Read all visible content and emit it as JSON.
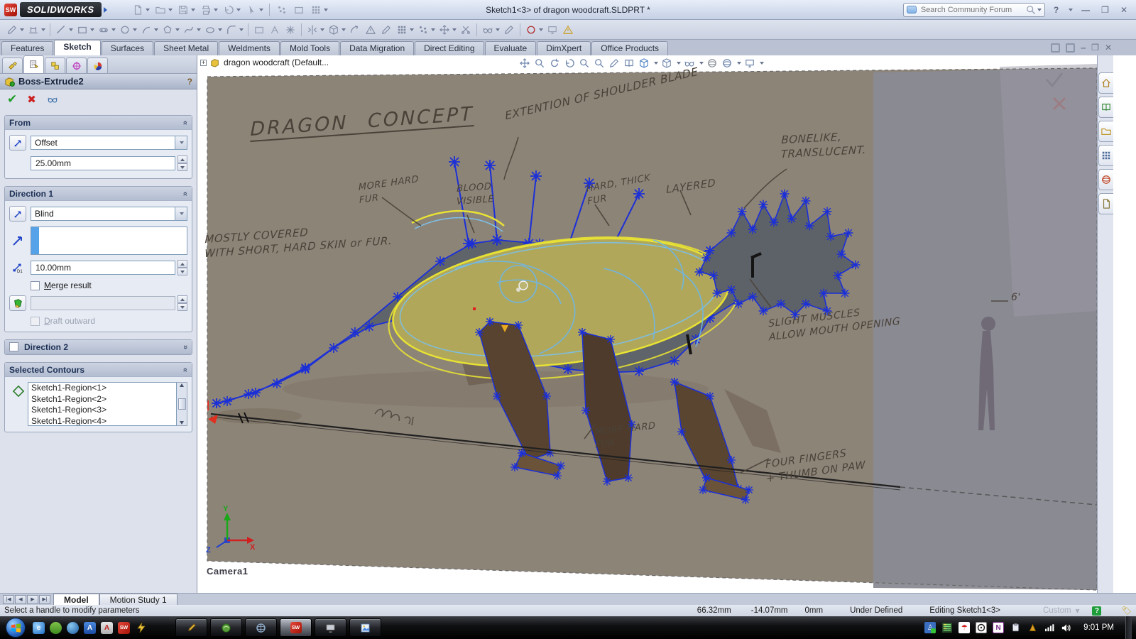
{
  "titlebar": {
    "brand": "SOLIDWORKS",
    "title": "Sketch1<3> of dragon woodcraft.SLDPRT *",
    "search_placeholder": "Search Community Forum"
  },
  "command_tabs": {
    "items": [
      "Features",
      "Sketch",
      "Surfaces",
      "Sheet Metal",
      "Weldments",
      "Mold Tools",
      "Data Migration",
      "Direct Editing",
      "Evaluate",
      "DimXpert",
      "Office Products"
    ],
    "active": "Sketch"
  },
  "feature_tree": {
    "document": "dragon woodcraft  (Default..."
  },
  "property_manager": {
    "title": "Boss-Extrude2",
    "help": "?",
    "from_group": {
      "label": "From",
      "start_condition": "Offset",
      "offset_value": "25.00mm"
    },
    "direction1_group": {
      "label": "Direction 1",
      "end_condition": "Blind",
      "depth_value": "10.00mm",
      "merge_checkbox": "Merge result",
      "draft_value": "",
      "draft_checkbox": "Draft outward",
      "depth_icon": "D1"
    },
    "direction2_group": {
      "label": "Direction 2"
    },
    "contours_group": {
      "label": "Selected Contours",
      "items": [
        "Sketch1-Region<1>",
        "Sketch1-Region<2>",
        "Sketch1-Region<3>",
        "Sketch1-Region<4>"
      ]
    }
  },
  "viewport": {
    "camera_label": "Camera1",
    "axis_labels": {
      "x": "X",
      "y": "Y",
      "z": "Z"
    },
    "annotations": [
      {
        "name": "dragon-concept-title",
        "text": "DRAGON  CONCEPT"
      },
      {
        "name": "shoulder-blade",
        "text": "EXTENTION OF SHOULDER BLADE"
      },
      {
        "name": "bonelike",
        "text": "BONELIKE,\nTRANSLUCENT."
      },
      {
        "name": "more-hard-fur-neck",
        "text": "MORE HARD\nFUR"
      },
      {
        "name": "blood-visible",
        "text": "BLOOD\nVISIBLE"
      },
      {
        "name": "hard-thick-fur",
        "text": "HARD, THICK\nFUR"
      },
      {
        "name": "layered",
        "text": "LAYERED"
      },
      {
        "name": "mostly-covered",
        "text": "MOSTLY COVERED\nWITH SHORT, HARD SKIN  or FUR."
      },
      {
        "name": "slight-muscles",
        "text": "SLIGHT MUSCLES\nALLOW MOUTH OPENING"
      },
      {
        "name": "more-hard-fur-leg",
        "text": "MORE HARD\nFUR"
      },
      {
        "name": "four-fingers",
        "text": "FOUR FINGERS\n+ THUMB ON PAW"
      },
      {
        "name": "height-mark",
        "text": "6'"
      }
    ]
  },
  "bottom_tabs": {
    "model": "Model",
    "motion_study": "Motion Study 1"
  },
  "status_bar": {
    "message": "Select a handle to modify parameters",
    "x": "66.32mm",
    "y": "-14.07mm",
    "z": "0mm",
    "state": "Under Defined",
    "editing": "Editing Sketch1<3>",
    "units": "Custom"
  },
  "taskbar": {
    "clock": "9:01 PM"
  }
}
